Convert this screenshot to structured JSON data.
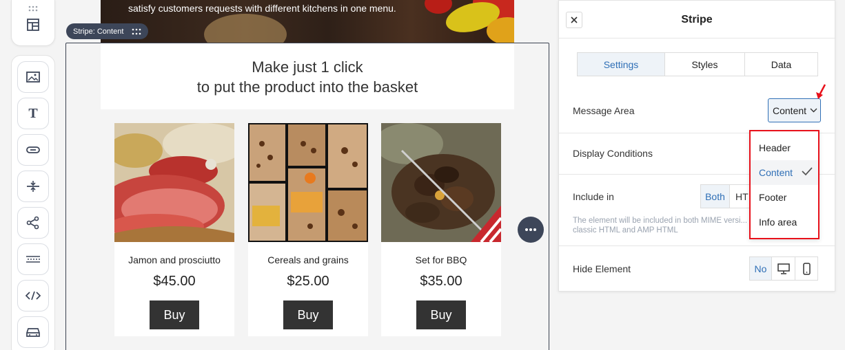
{
  "hero": {
    "text": "satisfy customers requests with different kitchens in one menu."
  },
  "stripe_badge": {
    "label": "Stripe: Content"
  },
  "promo": {
    "line1": "Make just 1 click",
    "line2": "to put the product into the basket"
  },
  "products": [
    {
      "name": "Jamon and prosciutto",
      "price": "$45.00",
      "buy": "Buy"
    },
    {
      "name": "Cereals and grains",
      "price": "$25.00",
      "buy": "Buy"
    },
    {
      "name": "Set for BBQ",
      "price": "$35.00",
      "buy": "Buy"
    }
  ],
  "toolbar": {
    "icons": [
      "structures-icon",
      "image-icon",
      "text-icon",
      "button-icon",
      "spacer-icon",
      "social-icon",
      "banner-icon",
      "html-code-icon",
      "video-icon"
    ]
  },
  "panel": {
    "title": "Stripe",
    "tabs": [
      {
        "label": "Settings",
        "active": true
      },
      {
        "label": "Styles",
        "active": false
      },
      {
        "label": "Data",
        "active": false
      }
    ],
    "message_area": {
      "label": "Message Area",
      "value": "Content"
    },
    "display_conditions": {
      "label": "Display Conditions"
    },
    "include_in": {
      "label": "Include in",
      "options": [
        "Both",
        "HT"
      ],
      "hint": "The element will be included in both MIME versi... classic HTML and AMP HTML"
    },
    "hide_element": {
      "label": "Hide Element",
      "option_no": "No"
    }
  },
  "dropdown": {
    "options": [
      "Header",
      "Content",
      "Footer",
      "Info area"
    ],
    "selected": "Content"
  },
  "colors": {
    "accent": "#2f6fb6",
    "highlight_border": "#e8101a",
    "dark_button": "#333333",
    "badge": "#3d4659"
  }
}
